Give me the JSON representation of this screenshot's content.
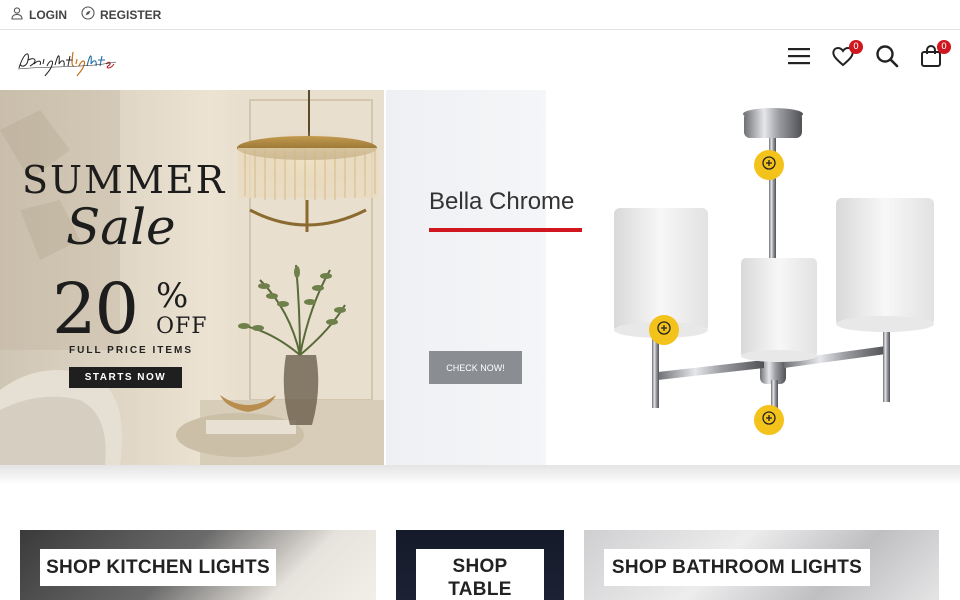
{
  "topbar": {
    "login_label": "LOGIN",
    "register_label": "REGISTER"
  },
  "header": {
    "logo_text": "Bright Lights",
    "wishlist_count": "0",
    "cart_count": "0",
    "icons": [
      "menu-icon",
      "heart-icon",
      "search-icon",
      "shopping-bag-icon"
    ]
  },
  "promo": {
    "line1": "SUMMER",
    "line2": "Sale",
    "percent_value": "20",
    "percent_sign": "%",
    "off": "OFF",
    "subline": "FULL PRICE ITEMS",
    "badge": "STARTS NOW"
  },
  "feature": {
    "title": "Bella Chrome",
    "button_label": "CHECK NOW!",
    "accent": "#d0161e",
    "hotspot_color": "#f3c21b"
  },
  "categories": [
    {
      "label": "SHOP KITCHEN LIGHTS"
    },
    {
      "label_line1": "SHOP",
      "label_line2": "TABLE"
    },
    {
      "label": "SHOP BATHROOM LIGHTS"
    }
  ]
}
